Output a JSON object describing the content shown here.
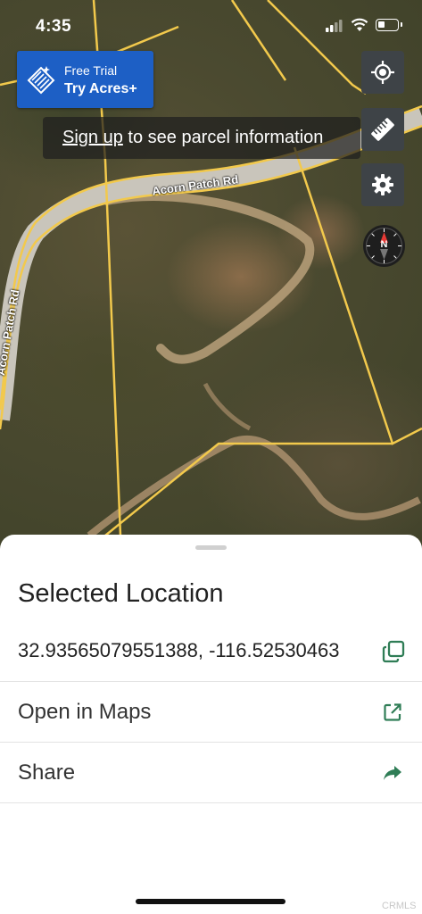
{
  "status_bar": {
    "time": "4:35"
  },
  "promo": {
    "line1": "Free Trial",
    "line2": "Try Acres+"
  },
  "tooltip": {
    "link": "Sign up",
    "rest": " to see parcel information"
  },
  "map": {
    "road_labels": [
      "Acorn Patch Rd",
      "Acorn Patch Rd"
    ],
    "compass_letter": "N",
    "icons": [
      "locate-icon",
      "ruler-icon",
      "gear-icon",
      "compass-icon"
    ]
  },
  "sheet": {
    "title": "Selected Location",
    "coordinates": "32.93565079551388, -116.52530463",
    "rows": [
      {
        "label": "Open in Maps",
        "icon": "external-link-icon"
      },
      {
        "label": "Share",
        "icon": "share-arrow-icon"
      }
    ],
    "watermark": "CRMLS"
  },
  "colors": {
    "accent_green": "#2f7d56",
    "promo_blue": "#1d5fc5",
    "parcel_line": "#f2c94c"
  }
}
